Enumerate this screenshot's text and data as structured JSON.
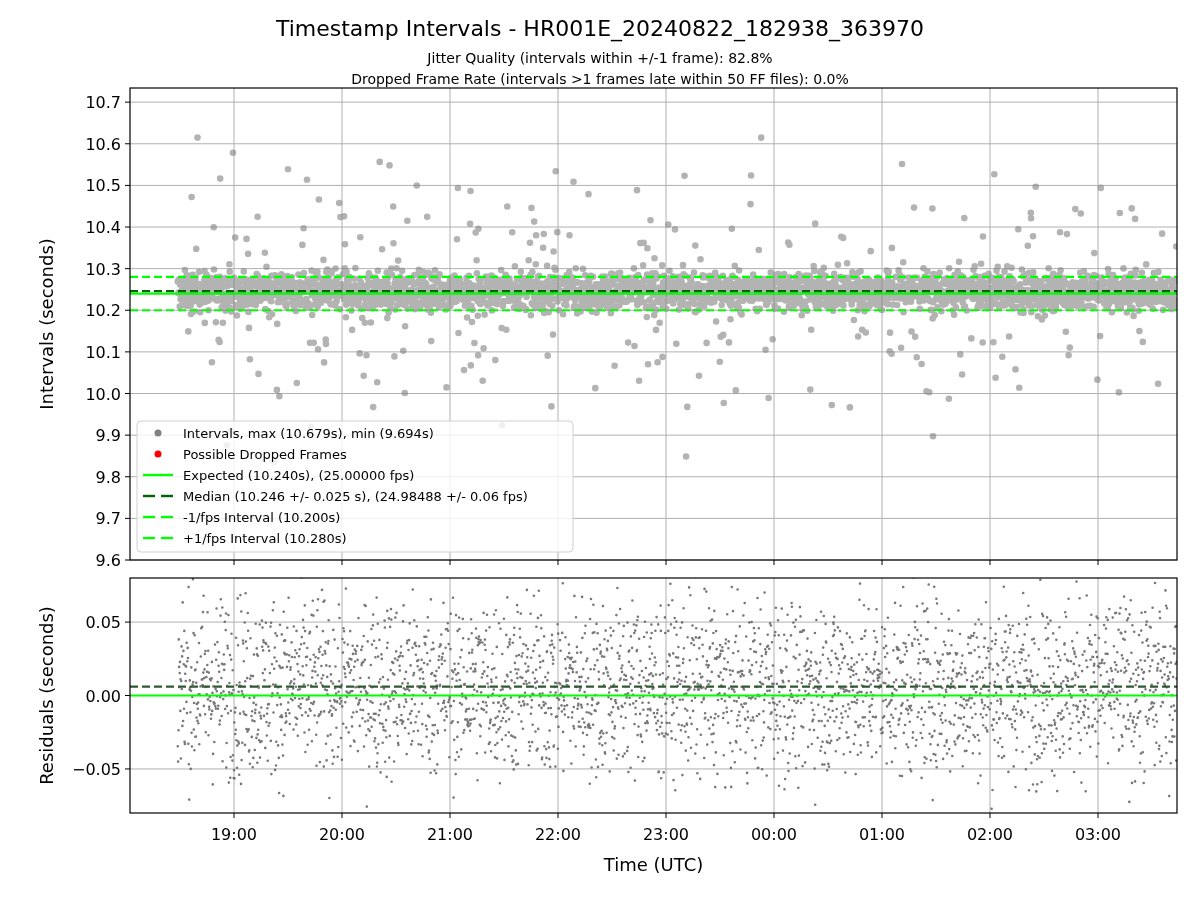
{
  "figure": {
    "title": "Timestamp Intervals - HR001E_20240822_182938_363970",
    "subtitles": [
      "Jitter Quality (intervals within +/-1 frame): 82.8%",
      "Dropped Frame Rate (intervals >1 frames late within 50 FF files): 0.0%"
    ]
  },
  "panels": [
    {
      "legend": [
        {
          "kind": "marker",
          "label": "Intervals, max (10.679s), min (9.694s)",
          "color": "#808080"
        },
        {
          "kind": "marker",
          "label": "Possible Dropped Frames",
          "color": "#ff0000"
        },
        {
          "kind": "line",
          "label": "Expected (10.240s), (25.00000 fps)",
          "color": "#00ff00"
        },
        {
          "kind": "dashed-line",
          "label": "Median (10.246 +/- 0.025 s), (24.98488 +/- 0.06 fps)",
          "color": "#006400"
        },
        {
          "kind": "dashed-line",
          "label": "-1/fps Interval (10.200s)",
          "color": "#00ff00"
        },
        {
          "kind": "dashed-line",
          "label": "+1/fps Interval (10.280s)",
          "color": "#00ff00"
        }
      ],
      "dashed_lines": [
        false,
        true,
        true,
        true
      ],
      "chart_data": {
        "type": "scatter",
        "ylabel": "Intervals (seconds)",
        "grid": true,
        "categories": [
          null,
          null,
          null,
          null,
          null,
          null,
          null,
          null,
          null
        ],
        "ylim": [
          9.6,
          10.734
        ],
        "yticks": [
          {
            "value": 9.6,
            "label": "9.6"
          },
          {
            "value": 9.7,
            "label": "9.7"
          },
          {
            "value": 9.8,
            "label": "9.8"
          },
          {
            "value": 9.9,
            "label": "9.9"
          },
          {
            "value": 10.0,
            "label": "10.0"
          },
          {
            "value": 10.1,
            "label": "10.1"
          },
          {
            "value": 10.2,
            "label": "10.2"
          },
          {
            "value": 10.3,
            "label": "10.3"
          },
          {
            "value": 10.4,
            "label": "10.4"
          },
          {
            "value": 10.5,
            "label": "10.5"
          },
          {
            "value": 10.6,
            "label": "10.6"
          },
          {
            "value": 10.7,
            "label": "10.7"
          }
        ],
        "ref_lines": [
          {
            "axis": "y",
            "value": 10.24,
            "color": "#00ff00"
          },
          {
            "axis": "y",
            "value": 10.246,
            "color": "#006400"
          },
          {
            "axis": "y",
            "value": 10.2,
            "color": "#00ff00"
          },
          {
            "axis": "y",
            "value": 10.28,
            "color": "#00ff00"
          }
        ]
      }
    },
    {
      "dashed_lines": [
        false,
        true
      ],
      "chart_data": {
        "type": "scatter",
        "xlabel": "Time (UTC)",
        "ylabel": "Residuals (seconds)",
        "grid": true,
        "categories": [
          "19:00",
          "20:00",
          "21:00",
          "22:00",
          "23:00",
          "00:00",
          "01:00",
          "02:00",
          "03:00"
        ],
        "ylim": [
          -0.08,
          0.08
        ],
        "yticks": [
          {
            "value": -0.05,
            "label": "−0.05"
          },
          {
            "value": 0,
            "label": "0.00"
          },
          {
            "value": 0.05,
            "label": "0.05"
          }
        ],
        "ref_lines": [
          {
            "axis": "y",
            "value": 0,
            "color": "#00ff00"
          },
          {
            "axis": "y",
            "value": 0.006,
            "color": "#2e5a2e"
          }
        ]
      }
    }
  ]
}
